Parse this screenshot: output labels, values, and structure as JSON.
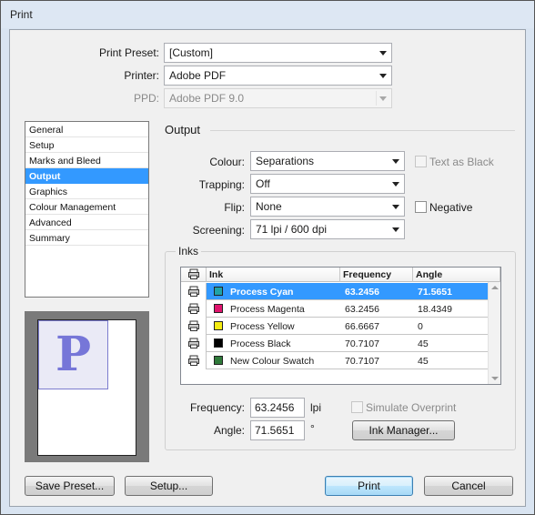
{
  "window": {
    "title": "Print"
  },
  "header": {
    "print_preset": {
      "label": "Print Preset:",
      "value": "[Custom]"
    },
    "printer": {
      "label": "Printer:",
      "value": "Adobe PDF"
    },
    "ppd": {
      "label": "PPD:",
      "value": "Adobe PDF 9.0"
    }
  },
  "sidebar": {
    "items": [
      {
        "label": "General"
      },
      {
        "label": "Setup"
      },
      {
        "label": "Marks and Bleed"
      },
      {
        "label": "Output",
        "selected": true
      },
      {
        "label": "Graphics"
      },
      {
        "label": "Colour Management"
      },
      {
        "label": "Advanced"
      },
      {
        "label": "Summary"
      }
    ]
  },
  "preview": {
    "letter": "P"
  },
  "output": {
    "section_title": "Output",
    "colour": {
      "label": "Colour:",
      "value": "Separations"
    },
    "trapping": {
      "label": "Trapping:",
      "value": "Off"
    },
    "flip": {
      "label": "Flip:",
      "value": "None"
    },
    "screening": {
      "label": "Screening:",
      "value": "71 lpi / 600 dpi"
    },
    "text_as_black": {
      "label": "Text as Black",
      "checked": false,
      "enabled": false
    },
    "negative": {
      "label": "Negative",
      "checked": false
    }
  },
  "inks": {
    "group_title": "Inks",
    "columns": [
      "Ink",
      "Frequency",
      "Angle"
    ],
    "rows": [
      {
        "ink": "Process Cyan",
        "frequency": "63.2456",
        "angle": "71.5651",
        "color": "#1fa3a8",
        "selected": true
      },
      {
        "ink": "Process Magenta",
        "frequency": "63.2456",
        "angle": "18.4349",
        "color": "#e0146e"
      },
      {
        "ink": "Process Yellow",
        "frequency": "66.6667",
        "angle": "0",
        "color": "#f5ec12"
      },
      {
        "ink": "Process Black",
        "frequency": "70.7107",
        "angle": "45",
        "color": "#000000"
      },
      {
        "ink": "New Colour Swatch",
        "frequency": "70.7107",
        "angle": "45",
        "color": "#2f7a3a"
      }
    ],
    "frequency": {
      "label": "Frequency:",
      "value": "63.2456",
      "unit": "lpi"
    },
    "angle": {
      "label": "Angle:",
      "value": "71.5651",
      "unit": "°"
    },
    "simulate_overprint": {
      "label": "Simulate Overprint",
      "checked": false,
      "enabled": false
    },
    "ink_manager_label": "Ink Manager..."
  },
  "footer": {
    "save_preset_label": "Save Preset...",
    "setup_label": "Setup...",
    "print_label": "Print",
    "cancel_label": "Cancel"
  }
}
